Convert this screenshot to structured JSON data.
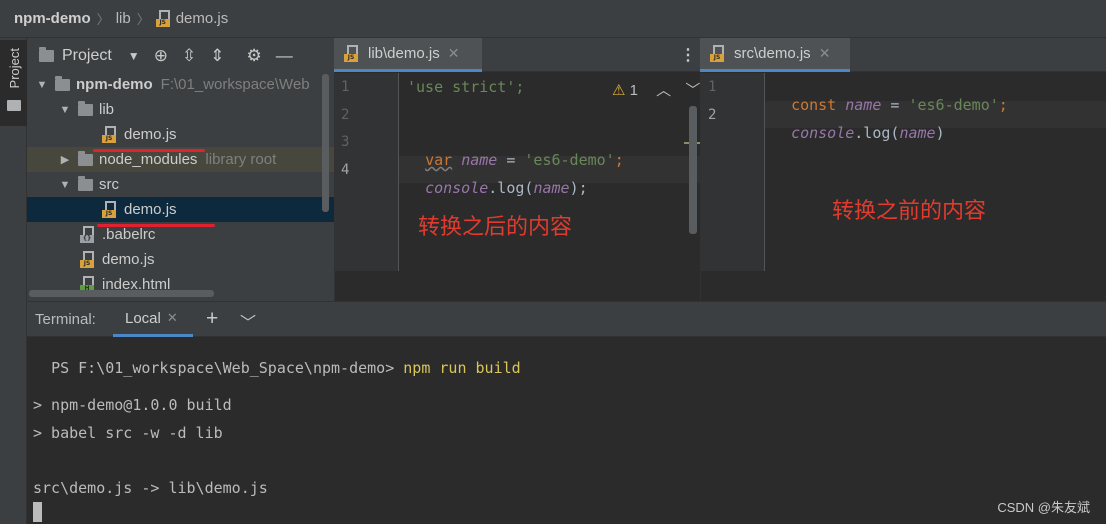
{
  "breadcrumb": {
    "project": "npm-demo",
    "folder": "lib",
    "file": "demo.js"
  },
  "left_strip": {
    "tab_label": "Project"
  },
  "project_panel": {
    "title": "Project",
    "tree": {
      "root": {
        "name": "npm-demo",
        "path": "F:\\01_workspace\\Web"
      },
      "lib": "lib",
      "lib_demo": "demo.js",
      "node_modules": "node_modules",
      "node_modules_hint": "library root",
      "src": "src",
      "src_demo": "demo.js",
      "babelrc": ".babelrc",
      "demo": "demo.js",
      "index": "index.html"
    }
  },
  "editor_left": {
    "tab": "lib\\demo.js",
    "warnings": "1",
    "line_numbers": [
      "1",
      "2",
      "3",
      "4"
    ],
    "line1": "'use strict';",
    "line3": {
      "kw": "var",
      "name": "name",
      "eq": " = ",
      "str": "'es6-demo'",
      "semi": ";"
    },
    "line4": {
      "obj": "console",
      "method": ".log(",
      "arg": "name",
      "end": ");"
    },
    "annotation": "转换之后的内容"
  },
  "editor_right": {
    "tab": "src\\demo.js",
    "line_numbers": [
      "1",
      "2"
    ],
    "line1": {
      "kw": "const",
      "name": "name",
      "eq": " = ",
      "str": "'es6-demo'",
      "semi": ";"
    },
    "line2": {
      "obj": "console",
      "method": ".log(",
      "arg": "name",
      "end": ")"
    },
    "annotation": "转换之前的内容"
  },
  "terminal": {
    "label": "Terminal:",
    "tab": "Local",
    "prompt": "PS F:\\01_workspace\\Web_Space\\npm-demo> ",
    "command": "npm run build",
    "out1": "> npm-demo@1.0.0 build",
    "out2": "> babel src -w -d lib",
    "out3": "src\\demo.js -> lib\\demo.js"
  },
  "watermark": "CSDN @朱友斌",
  "colors": {
    "accent": "#4a88c7",
    "annotation": "#e23b2e",
    "string": "#6a8759",
    "keyword": "#cc7832"
  }
}
